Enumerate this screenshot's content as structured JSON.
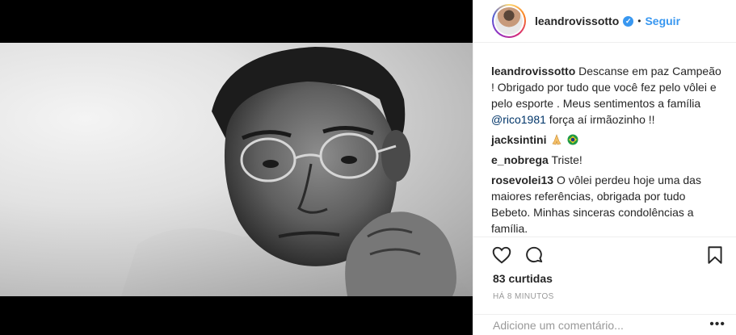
{
  "post": {
    "username": "leandrovissotto",
    "follow_label": "Seguir",
    "separator": "•"
  },
  "comments": [
    {
      "user": "leandrovissotto",
      "text_before": "Descanse em paz Campeão ! Obrigado por tudo que você fez pelo vôlei e pelo esporte . Meus sentimentos a família ",
      "mention": "@rico1981",
      "text_after": " força aí irmãozinho !!"
    },
    {
      "user": "jacksintini",
      "text": ""
    },
    {
      "user": "e_nobrega",
      "text": "Triste!"
    },
    {
      "user": "rosevolei13",
      "text": "O vôlei perdeu hoje uma das maiores referências, obrigada por tudo Bebeto. Minhas sinceras condolências a família."
    }
  ],
  "likes": "83 curtidas",
  "time": "HÁ 8 MINUTOS",
  "add_comment": {
    "placeholder": "Adicione um comentário...",
    "more": "•••"
  },
  "colors": {
    "accent": "#3897f0",
    "mention": "#003569",
    "muted": "#999999"
  },
  "icons": [
    "verified-badge-icon",
    "heart-icon",
    "comment-icon",
    "bookmark-icon",
    "praying-hands-emoji",
    "brazil-flag-emoji",
    "more-options-icon"
  ]
}
